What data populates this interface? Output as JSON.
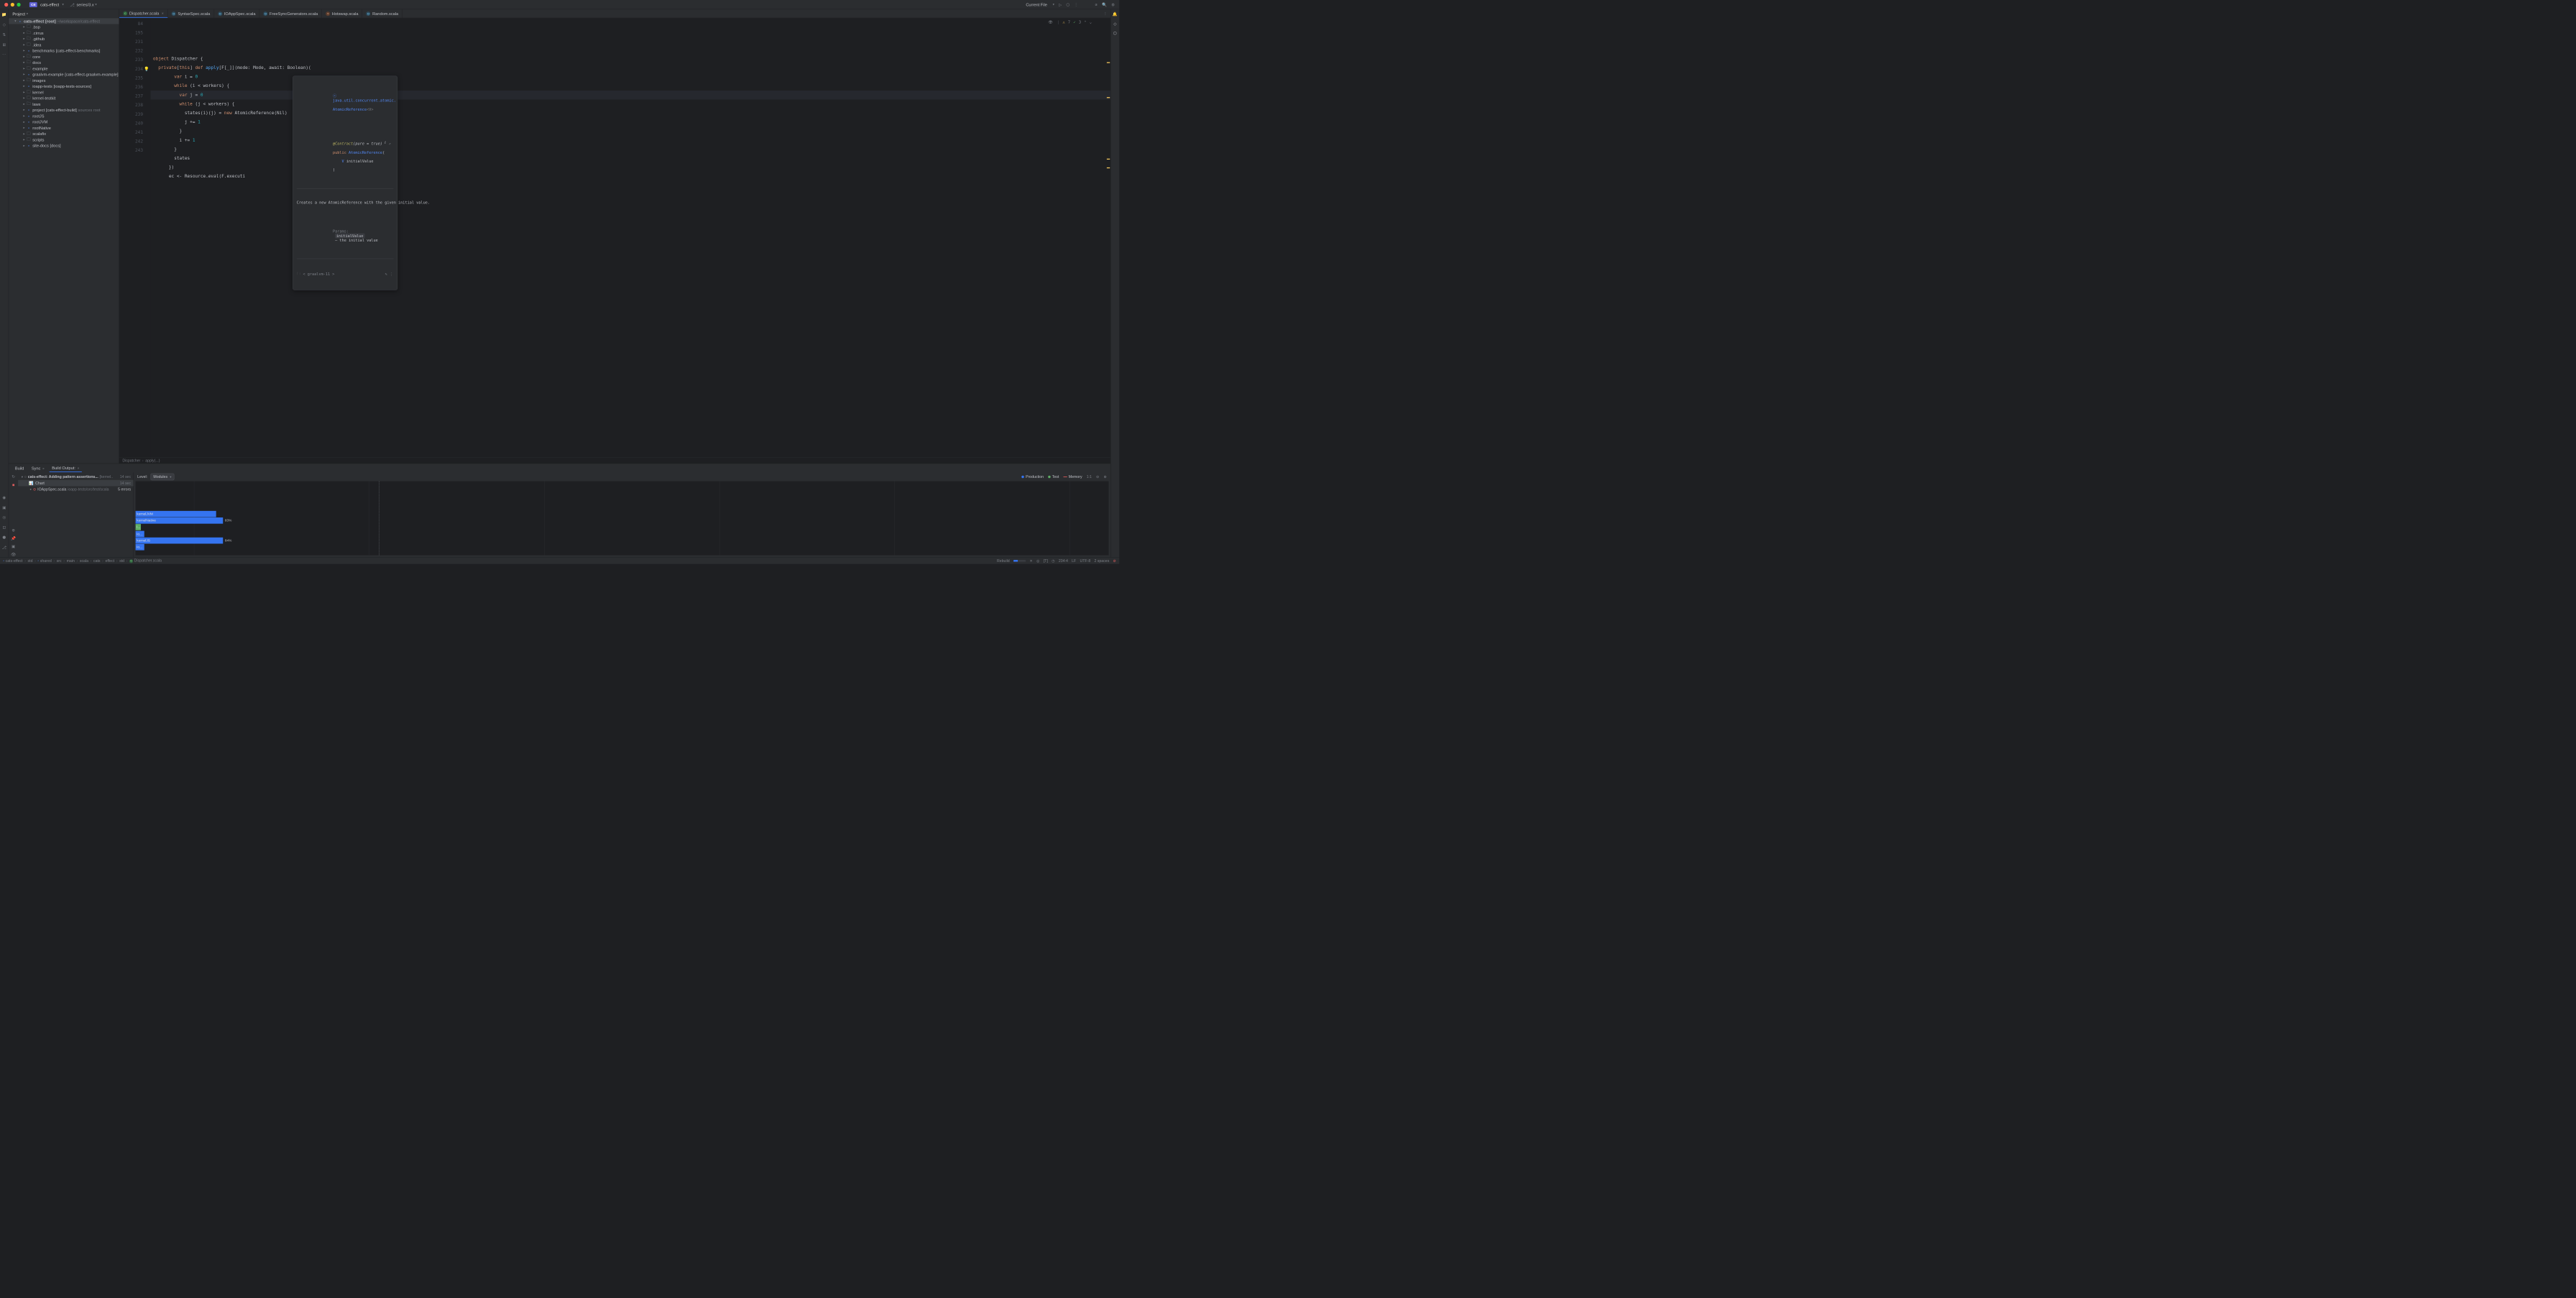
{
  "window": {
    "project_chip": "CE",
    "project_name": "cats-effect",
    "branch": "series/3.x",
    "current_file_label": "Current File"
  },
  "project_panel": {
    "title": "Project",
    "root_name": "cats-effect",
    "root_tag": "[root]",
    "root_path": "~/workspace/cats-effect",
    "items": [
      {
        "indent": 2,
        "arrow": ">",
        "icon": "folder",
        "label": ".bsp"
      },
      {
        "indent": 2,
        "arrow": ">",
        "icon": "folder",
        "label": ".cirrus"
      },
      {
        "indent": 2,
        "arrow": ">",
        "icon": "folder",
        "label": ".github"
      },
      {
        "indent": 2,
        "arrow": ">",
        "icon": "folder",
        "label": ".idea"
      },
      {
        "indent": 2,
        "arrow": ">",
        "icon": "module",
        "label": "benchmarks",
        "sub": "[cats-effect-benchmarks]"
      },
      {
        "indent": 2,
        "arrow": ">",
        "icon": "folder",
        "label": "core"
      },
      {
        "indent": 2,
        "arrow": ">",
        "icon": "folder",
        "label": "docs"
      },
      {
        "indent": 2,
        "arrow": ">",
        "icon": "folder",
        "label": "example"
      },
      {
        "indent": 2,
        "arrow": ">",
        "icon": "module",
        "label": "graalvm-example",
        "sub": "[cats-effect-graalvm-example]"
      },
      {
        "indent": 2,
        "arrow": ">",
        "icon": "folder",
        "label": "images"
      },
      {
        "indent": 2,
        "arrow": ">",
        "icon": "module",
        "label": "ioapp-tests",
        "sub": "[ioapp-tests-sources]"
      },
      {
        "indent": 2,
        "arrow": ">",
        "icon": "folder",
        "label": "kernel"
      },
      {
        "indent": 2,
        "arrow": ">",
        "icon": "folder",
        "label": "kernel-testkit"
      },
      {
        "indent": 2,
        "arrow": ">",
        "icon": "folder",
        "label": "laws"
      },
      {
        "indent": 2,
        "arrow": ">",
        "icon": "module",
        "label": "project",
        "sub": "[cats-effect-build]",
        "sub2": "sources root"
      },
      {
        "indent": 2,
        "arrow": ">",
        "icon": "module",
        "label": "rootJS"
      },
      {
        "indent": 2,
        "arrow": ">",
        "icon": "module",
        "label": "rootJVM"
      },
      {
        "indent": 2,
        "arrow": ">",
        "icon": "module",
        "label": "rootNative"
      },
      {
        "indent": 2,
        "arrow": ">",
        "icon": "folder",
        "label": "scalafix"
      },
      {
        "indent": 2,
        "arrow": ">",
        "icon": "folder",
        "label": "scripts"
      },
      {
        "indent": 2,
        "arrow": ">",
        "icon": "module",
        "label": "site-docs",
        "sub": "[docs]"
      }
    ]
  },
  "tabs": [
    {
      "icon": "class",
      "label": "Dispatcher.scala",
      "closable": true,
      "active": true
    },
    {
      "icon": "obj",
      "label": "SyntaxSpec.scala"
    },
    {
      "icon": "obj",
      "label": "IOAppSpec.scala"
    },
    {
      "icon": "obj",
      "label": "FreeSyncGenerators.scala"
    },
    {
      "icon": "trait",
      "label": "Hotswap.scala"
    },
    {
      "icon": "obj",
      "label": "Random.scala"
    }
  ],
  "editor": {
    "warnings": "7",
    "oks": "3",
    "lines": [
      {
        "n": "84",
        "html": "<span class='kw'>object</span> <span class='ident'>Dispatcher</span> {"
      },
      {
        "n": "195",
        "html": "  <span class='kw'>private</span>[<span class='kw'>this</span>] <span class='kw'>def</span> <span class='fn'>apply</span>[<span class='type'>F</span>[_]](mode: Mode, await: Boolean)("
      },
      {
        "n": "231",
        "html": "        <span class='kw'>var</span> i = <span class='num'>0</span>"
      },
      {
        "n": "232",
        "html": "        <span class='kw'>while</span> (i &lt; workers) {"
      },
      {
        "n": "233",
        "html": "          <span class='kw'>var</span> j = <span class='num'>0</span>",
        "hl": true
      },
      {
        "n": "234",
        "html": "          <span class='kw'>while</span> (j &lt; workers) {",
        "bulb": true
      },
      {
        "n": "235",
        "html": "            states(i)(j) = <span class='kw'>new</span> AtomicReference(Nil)"
      },
      {
        "n": "236",
        "html": "            j += <span class='num'>1</span>"
      },
      {
        "n": "237",
        "html": "          }"
      },
      {
        "n": "238",
        "html": "          i += <span class='num'>1</span>"
      },
      {
        "n": "239",
        "html": "        }"
      },
      {
        "n": "240",
        "html": "        states"
      },
      {
        "n": "241",
        "html": "      })"
      },
      {
        "n": "242",
        "html": "      ec &lt;- Resource.<span class='italic'>eval</span>(F.executi"
      },
      {
        "n": "243",
        "html": ""
      }
    ],
    "breadcrumb": [
      "Dispatcher",
      "apply(...)"
    ]
  },
  "doc_popup": {
    "pkg": "java.util.concurrent.atomic.",
    "cls": "AtomicReference",
    "type_param": "<V>",
    "contract": "@Contract",
    "contract_args": "(pure = true)",
    "sig_public": "public",
    "sig_name": "AtomicReference",
    "sig_param_type": "V",
    "sig_param_name": "initialValue",
    "desc": "Creates a new AtomicReference with the given initial value.",
    "params_label": "Params:",
    "param_name": "initialValue",
    "param_desc": "– the initial value",
    "jdk": "< graalvm-11 >"
  },
  "bottom": {
    "tabs": [
      {
        "label": "Build"
      },
      {
        "label": "Sync",
        "closable": true
      },
      {
        "label": "Build Output:",
        "closable": true,
        "active": true
      }
    ],
    "tree": {
      "root": "cats-effect: Adding pattern assertions...",
      "root_sub": "[kernel..",
      "root_time": "14 sec",
      "chart_label": "Chart",
      "chart_time": "14 sec",
      "file": "IOAppSpec.scala",
      "file_path": "ioapp-tests/src/test/scala",
      "file_errors": "5 errors"
    },
    "level_label": "Level:",
    "level_value": "Modules",
    "legend": [
      {
        "color": "#3574f0",
        "label": "Production"
      },
      {
        "color": "#5fad65",
        "label": "Test"
      },
      {
        "color": "#db5c5c",
        "label": "Memory",
        "dash": true
      }
    ],
    "ratio": "1:1"
  },
  "chart_data": {
    "type": "bar",
    "orientation": "horizontal",
    "title": "",
    "xlabel": "",
    "ylabel": "",
    "x_unit": "percent_of_total_build_time",
    "grid_positions_pct": [
      6,
      24,
      42,
      60,
      78,
      96
    ],
    "bars": [
      {
        "label": "kernelJVM",
        "width_pct": 23,
        "color": "#3574f0",
        "text_shown": ""
      },
      {
        "label": "kernelNative",
        "width_pct": 25,
        "color": "#3574f0",
        "text_shown": "83%"
      },
      {
        "label": "i...",
        "width_pct": 1.5,
        "color": "#5fad65",
        "text_shown": ""
      },
      {
        "label": "io...",
        "width_pct": 2.5,
        "color": "#3574f0",
        "text_shown": ""
      },
      {
        "label": "kernelJS",
        "width_pct": 25,
        "color": "#3574f0",
        "text_shown": "84%"
      },
      {
        "label": "io...",
        "width_pct": 2.5,
        "color": "#3574f0",
        "text_shown": ""
      }
    ],
    "row_top_pct": [
      40,
      49,
      58,
      67,
      76,
      85
    ]
  },
  "status_bar": {
    "crumbs": [
      "cats-effect",
      "std",
      "shared",
      "src",
      "main",
      "scala",
      "cats",
      "effect",
      "std",
      "Dispatcher.scala"
    ],
    "rebuild": "Rebuild",
    "cursor": "234:4",
    "line_sep": "LF",
    "encoding": "UTF-8",
    "indent": "2 spaces"
  }
}
